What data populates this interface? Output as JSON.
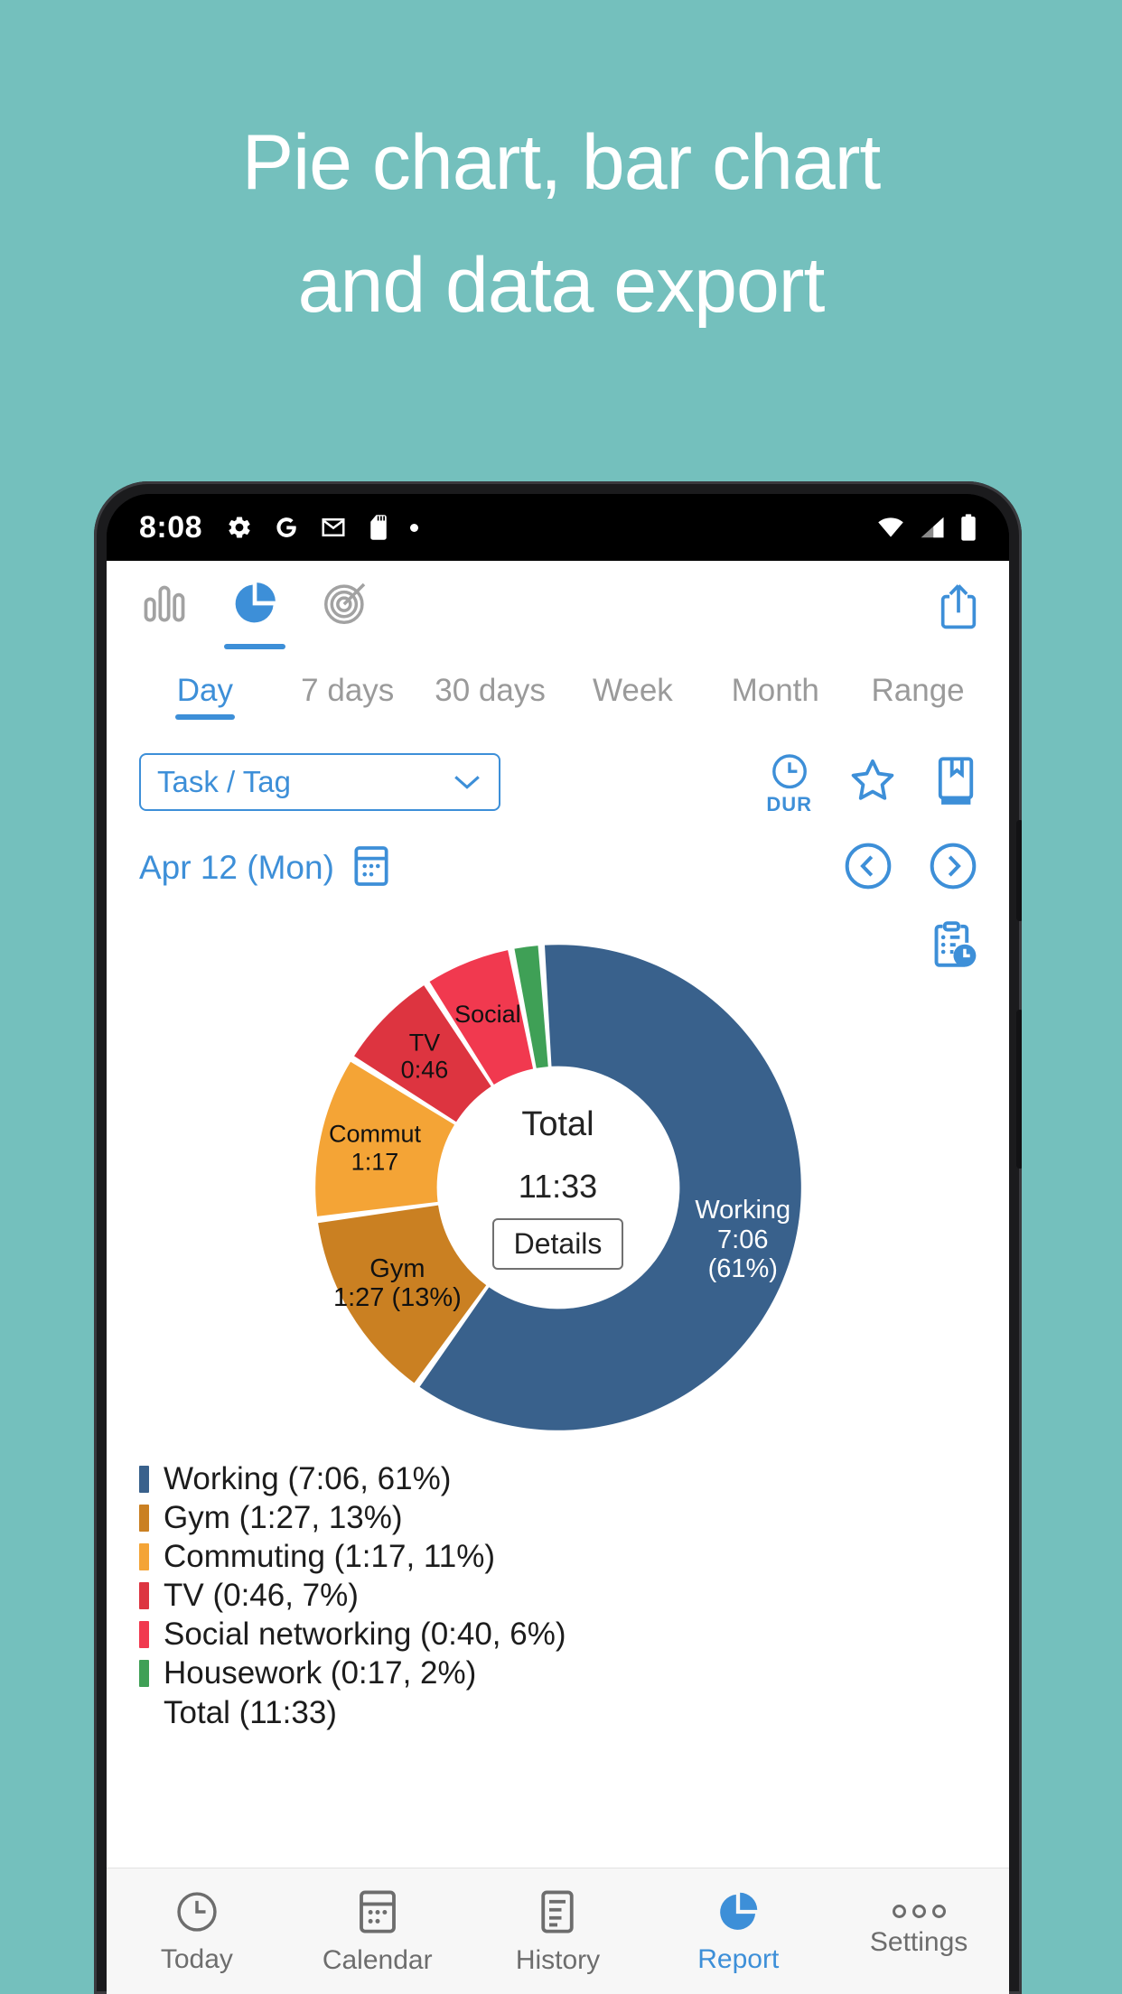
{
  "headline": {
    "line1": "Pie chart, bar chart",
    "line2": "and data export"
  },
  "colors": {
    "background": "#74c0bd",
    "accent": "#3d8fd8",
    "inactive": "#9a9a9a"
  },
  "status_bar": {
    "time": "8:08",
    "left_icons": [
      "gear-icon",
      "google-g-icon",
      "gmail-icon",
      "sd-card-icon",
      "dot-icon"
    ],
    "right_icons": [
      "wifi-icon",
      "cellular-signal-icon",
      "battery-icon"
    ]
  },
  "toolbar": {
    "icons": [
      {
        "name": "bar-chart-icon",
        "active": false
      },
      {
        "name": "pie-chart-icon",
        "active": true
      },
      {
        "name": "goal-target-icon",
        "active": false
      }
    ],
    "share_label": "share-export-icon"
  },
  "tabs": [
    {
      "label": "Day",
      "active": true
    },
    {
      "label": "7 days",
      "active": false
    },
    {
      "label": "30 days",
      "active": false
    },
    {
      "label": "Week",
      "active": false
    },
    {
      "label": "Month",
      "active": false
    },
    {
      "label": "Range",
      "active": false
    }
  ],
  "filter": {
    "select_value": "Task / Tag",
    "dur_label": "DUR",
    "icons": [
      "duration-clock-icon",
      "star-icon",
      "bookmark-icon"
    ]
  },
  "date_nav": {
    "date": "Apr 12 (Mon)",
    "calendar_icon": "calendar-icon",
    "prev": "chevron-left-icon",
    "next": "chevron-right-icon"
  },
  "report_icon": "clipboard-clock-icon",
  "center": {
    "total_label": "Total",
    "total_value": "11:33",
    "details_button": "Details"
  },
  "chart_data": {
    "type": "pie",
    "title": "Time by task (Apr 12, Mon)",
    "total_label": "Total",
    "total_value": "11:33",
    "legend_position": "below",
    "categories": [
      "Working",
      "Gym",
      "Commuting",
      "TV",
      "Social networking",
      "Housework"
    ],
    "values": [
      61,
      13,
      11,
      7,
      6,
      2
    ],
    "durations": [
      "7:06",
      "1:27",
      "1:17",
      "0:46",
      "0:40",
      "0:17"
    ],
    "colors": [
      "#39618c",
      "#ca8022",
      "#f4a436",
      "#dd3440",
      "#f1394f",
      "#3fa056"
    ],
    "slice_labels": [
      {
        "name": "Working",
        "text_line1": "Working",
        "text_line2": "7:06 (61%)",
        "on_slice": true
      },
      {
        "name": "Gym",
        "text_line1": "Gym",
        "text_line2": "1:27 (13%)",
        "on_slice": true
      },
      {
        "name": "Commuting",
        "text_line1": "Commut",
        "text_line2": "1:17",
        "on_slice": true
      },
      {
        "name": "TV",
        "text_line1": "TV",
        "text_line2": "0:46",
        "on_slice": true
      },
      {
        "name": "Social networking",
        "text_line1": "Social",
        "text_line2": "",
        "on_slice": true
      },
      {
        "name": "Housework",
        "text_line1": "",
        "text_line2": "",
        "on_slice": false
      }
    ],
    "legend": [
      {
        "label": "Working (7:06, 61%)",
        "color": "#39618c"
      },
      {
        "label": "Gym (1:27, 13%)",
        "color": "#ca8022"
      },
      {
        "label": "Commuting (1:17, 11%)",
        "color": "#f4a436"
      },
      {
        "label": "TV (0:46, 7%)",
        "color": "#dd3440"
      },
      {
        "label": "Social networking (0:40, 6%)",
        "color": "#f1394f"
      },
      {
        "label": "Housework (0:17, 2%)",
        "color": "#3fa056"
      }
    ],
    "legend_total": "Total (11:33)"
  },
  "bottom_nav": [
    {
      "label": "Today",
      "icon": "clock-icon",
      "active": false
    },
    {
      "label": "Calendar",
      "icon": "calendar-icon",
      "active": false
    },
    {
      "label": "History",
      "icon": "list-history-icon",
      "active": false
    },
    {
      "label": "Report",
      "icon": "pie-chart-icon",
      "active": true
    },
    {
      "label": "Settings",
      "icon": "more-dots-icon",
      "active": false
    }
  ]
}
